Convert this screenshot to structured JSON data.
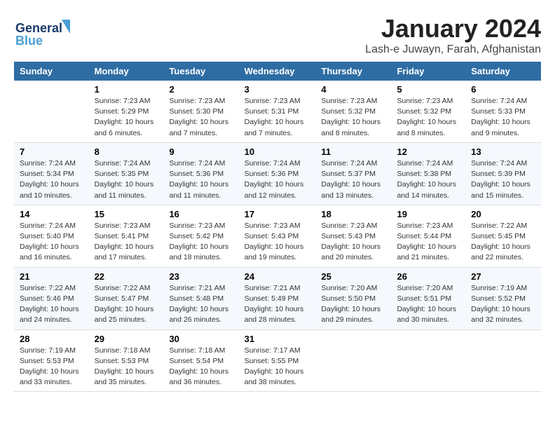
{
  "header": {
    "logo_line1": "General",
    "logo_line2": "Blue",
    "month_title": "January 2024",
    "location": "Lash-e Juwayn, Farah, Afghanistan"
  },
  "columns": [
    "Sunday",
    "Monday",
    "Tuesday",
    "Wednesday",
    "Thursday",
    "Friday",
    "Saturday"
  ],
  "weeks": [
    [
      {
        "day": "",
        "info": ""
      },
      {
        "day": "1",
        "info": "Sunrise: 7:23 AM\nSunset: 5:29 PM\nDaylight: 10 hours\nand 6 minutes."
      },
      {
        "day": "2",
        "info": "Sunrise: 7:23 AM\nSunset: 5:30 PM\nDaylight: 10 hours\nand 7 minutes."
      },
      {
        "day": "3",
        "info": "Sunrise: 7:23 AM\nSunset: 5:31 PM\nDaylight: 10 hours\nand 7 minutes."
      },
      {
        "day": "4",
        "info": "Sunrise: 7:23 AM\nSunset: 5:32 PM\nDaylight: 10 hours\nand 8 minutes."
      },
      {
        "day": "5",
        "info": "Sunrise: 7:23 AM\nSunset: 5:32 PM\nDaylight: 10 hours\nand 8 minutes."
      },
      {
        "day": "6",
        "info": "Sunrise: 7:24 AM\nSunset: 5:33 PM\nDaylight: 10 hours\nand 9 minutes."
      }
    ],
    [
      {
        "day": "7",
        "info": "Sunrise: 7:24 AM\nSunset: 5:34 PM\nDaylight: 10 hours\nand 10 minutes."
      },
      {
        "day": "8",
        "info": "Sunrise: 7:24 AM\nSunset: 5:35 PM\nDaylight: 10 hours\nand 11 minutes."
      },
      {
        "day": "9",
        "info": "Sunrise: 7:24 AM\nSunset: 5:36 PM\nDaylight: 10 hours\nand 11 minutes."
      },
      {
        "day": "10",
        "info": "Sunrise: 7:24 AM\nSunset: 5:36 PM\nDaylight: 10 hours\nand 12 minutes."
      },
      {
        "day": "11",
        "info": "Sunrise: 7:24 AM\nSunset: 5:37 PM\nDaylight: 10 hours\nand 13 minutes."
      },
      {
        "day": "12",
        "info": "Sunrise: 7:24 AM\nSunset: 5:38 PM\nDaylight: 10 hours\nand 14 minutes."
      },
      {
        "day": "13",
        "info": "Sunrise: 7:24 AM\nSunset: 5:39 PM\nDaylight: 10 hours\nand 15 minutes."
      }
    ],
    [
      {
        "day": "14",
        "info": "Sunrise: 7:24 AM\nSunset: 5:40 PM\nDaylight: 10 hours\nand 16 minutes."
      },
      {
        "day": "15",
        "info": "Sunrise: 7:23 AM\nSunset: 5:41 PM\nDaylight: 10 hours\nand 17 minutes."
      },
      {
        "day": "16",
        "info": "Sunrise: 7:23 AM\nSunset: 5:42 PM\nDaylight: 10 hours\nand 18 minutes."
      },
      {
        "day": "17",
        "info": "Sunrise: 7:23 AM\nSunset: 5:43 PM\nDaylight: 10 hours\nand 19 minutes."
      },
      {
        "day": "18",
        "info": "Sunrise: 7:23 AM\nSunset: 5:43 PM\nDaylight: 10 hours\nand 20 minutes."
      },
      {
        "day": "19",
        "info": "Sunrise: 7:23 AM\nSunset: 5:44 PM\nDaylight: 10 hours\nand 21 minutes."
      },
      {
        "day": "20",
        "info": "Sunrise: 7:22 AM\nSunset: 5:45 PM\nDaylight: 10 hours\nand 22 minutes."
      }
    ],
    [
      {
        "day": "21",
        "info": "Sunrise: 7:22 AM\nSunset: 5:46 PM\nDaylight: 10 hours\nand 24 minutes."
      },
      {
        "day": "22",
        "info": "Sunrise: 7:22 AM\nSunset: 5:47 PM\nDaylight: 10 hours\nand 25 minutes."
      },
      {
        "day": "23",
        "info": "Sunrise: 7:21 AM\nSunset: 5:48 PM\nDaylight: 10 hours\nand 26 minutes."
      },
      {
        "day": "24",
        "info": "Sunrise: 7:21 AM\nSunset: 5:49 PM\nDaylight: 10 hours\nand 28 minutes."
      },
      {
        "day": "25",
        "info": "Sunrise: 7:20 AM\nSunset: 5:50 PM\nDaylight: 10 hours\nand 29 minutes."
      },
      {
        "day": "26",
        "info": "Sunrise: 7:20 AM\nSunset: 5:51 PM\nDaylight: 10 hours\nand 30 minutes."
      },
      {
        "day": "27",
        "info": "Sunrise: 7:19 AM\nSunset: 5:52 PM\nDaylight: 10 hours\nand 32 minutes."
      }
    ],
    [
      {
        "day": "28",
        "info": "Sunrise: 7:19 AM\nSunset: 5:53 PM\nDaylight: 10 hours\nand 33 minutes."
      },
      {
        "day": "29",
        "info": "Sunrise: 7:18 AM\nSunset: 5:53 PM\nDaylight: 10 hours\nand 35 minutes."
      },
      {
        "day": "30",
        "info": "Sunrise: 7:18 AM\nSunset: 5:54 PM\nDaylight: 10 hours\nand 36 minutes."
      },
      {
        "day": "31",
        "info": "Sunrise: 7:17 AM\nSunset: 5:55 PM\nDaylight: 10 hours\nand 38 minutes."
      },
      {
        "day": "",
        "info": ""
      },
      {
        "day": "",
        "info": ""
      },
      {
        "day": "",
        "info": ""
      }
    ]
  ]
}
